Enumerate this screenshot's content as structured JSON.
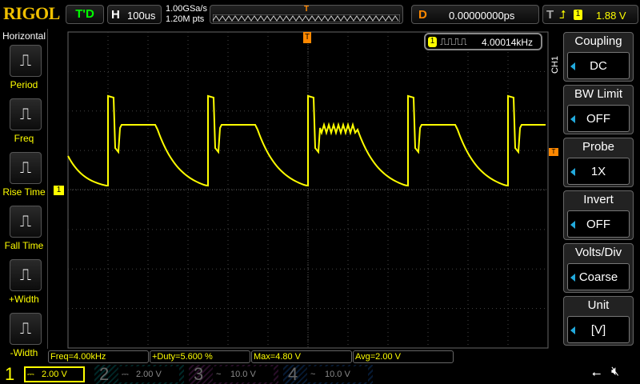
{
  "header": {
    "logo": "RIGOL",
    "status": "T'D",
    "timebase_label": "H",
    "timebase": "100us",
    "sample_rate": "1.00GSa/s",
    "memory_depth": "1.20M pts",
    "delay_label": "D",
    "delay": "0.00000000ps",
    "trigger_label": "T",
    "trigger_source": "1",
    "trigger_level": "1.88 V"
  },
  "left_menu": {
    "title": "Horizontal",
    "items": [
      {
        "label": "Period",
        "icon": "period-icon"
      },
      {
        "label": "Freq",
        "icon": "frequency-icon"
      },
      {
        "label": "Rise Time",
        "icon": "rise-time-icon"
      },
      {
        "label": "Fall Time",
        "icon": "fall-time-icon"
      },
      {
        "label": "+Width",
        "icon": "positive-width-icon"
      },
      {
        "label": "-Width",
        "icon": "negative-width-icon"
      }
    ]
  },
  "freq_counter": {
    "channel": "1",
    "value": "4.00014kHz"
  },
  "right_menu": {
    "channel": "CH1",
    "items": [
      {
        "label": "Coupling",
        "value": "DC"
      },
      {
        "label": "BW Limit",
        "value": "OFF"
      },
      {
        "label": "Probe",
        "value": "1X"
      },
      {
        "label": "Invert",
        "value": "OFF"
      },
      {
        "label": "Volts/Div",
        "value": "Coarse"
      },
      {
        "label": "Unit",
        "value": "[V]"
      }
    ]
  },
  "measurements": [
    "Freq=4.00kHz",
    "+Duty=5.600 %",
    "Max=4.80 V",
    "Avg=2.00 V"
  ],
  "channels": [
    {
      "num": "1",
      "coupling": "DC",
      "scale": "2.00 V",
      "color": "#ffff00",
      "active": true
    },
    {
      "num": "2",
      "coupling": "DC",
      "scale": "2.00 V",
      "color": "#00c0c0",
      "active": false
    },
    {
      "num": "3",
      "coupling": "AC",
      "scale": "10.0 V",
      "color": "#c040c0",
      "active": false
    },
    {
      "num": "4",
      "coupling": "AC",
      "scale": "10.0 V",
      "color": "#2080ff",
      "active": false
    }
  ],
  "colors": {
    "ch1": "#ffff00",
    "trigger": "#ff8000",
    "accent": "#22aadd"
  },
  "markers": {
    "channel": "1",
    "trigger": "T"
  }
}
